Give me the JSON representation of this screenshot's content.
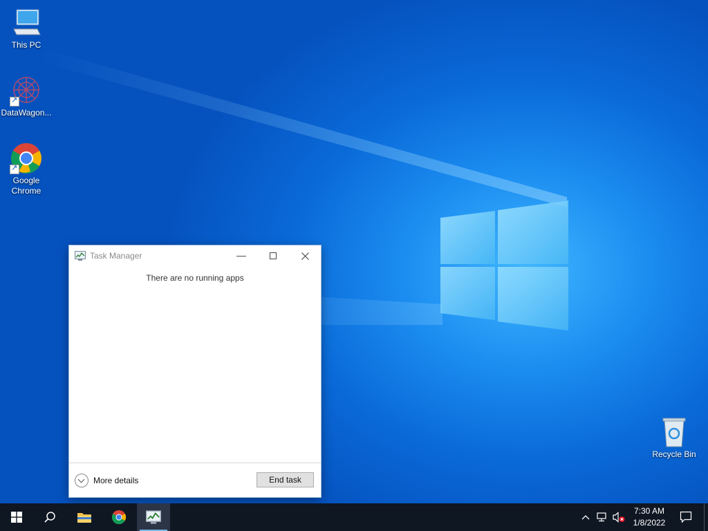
{
  "desktop": {
    "icons": [
      {
        "label": "This PC",
        "icon": "computer-icon"
      },
      {
        "label": "DataWagon...",
        "icon": "datawagon-app-icon"
      },
      {
        "label": "Google Chrome",
        "icon": "chrome-icon"
      },
      {
        "label": "Recycle Bin",
        "icon": "recycle-bin-icon"
      }
    ]
  },
  "task_manager": {
    "title": "Task Manager",
    "message": "There are no running apps",
    "more_details_label": "More details",
    "end_task_label": "End task",
    "controls": {
      "minimize": "minimize-icon",
      "maximize": "maximize-icon",
      "close": "close-icon"
    }
  },
  "taskbar": {
    "items": [
      {
        "name": "start",
        "icon": "windows-logo-icon"
      },
      {
        "name": "search",
        "icon": "search-icon"
      },
      {
        "name": "file-explorer",
        "icon": "folder-icon"
      },
      {
        "name": "chrome",
        "icon": "chrome-icon"
      },
      {
        "name": "task-manager",
        "icon": "task-manager-icon",
        "active": true
      }
    ],
    "tray": {
      "icons": [
        "chevron-up-icon",
        "network-icon",
        "volume-muted-icon"
      ],
      "time": "7:30 AM",
      "date": "1/8/2022",
      "notification_icon": "action-center-icon"
    }
  },
  "colors": {
    "taskbar": "#0f1723",
    "accent": "#76b9ed",
    "desktop_blue": "#0a6ad8"
  }
}
